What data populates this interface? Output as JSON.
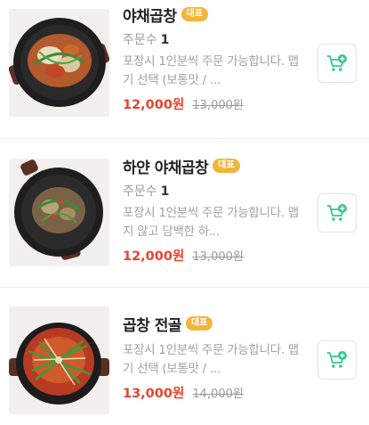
{
  "menu": {
    "items": [
      {
        "title": "야채곱창",
        "badge": "대표",
        "orders_label": "주문수",
        "orders_count": "1",
        "description": "포장시 1인분씩 주문 가능합니다. 맵기 선택 (보통맛 / ...",
        "price": "12,000원",
        "original_price": "13,000원",
        "image_icon": "stir-fried-tripe-pan-image"
      },
      {
        "title": "하얀 야채곱창",
        "badge": "대표",
        "orders_label": "주문수",
        "orders_count": "1",
        "description": "포장시 1인분씩 주문 가능합니다. 맵지 않고 담백한 하...",
        "price": "12,000원",
        "original_price": "13,000원",
        "image_icon": "white-tripe-pan-image"
      },
      {
        "title": "곱창 전골",
        "badge": "대표",
        "description": "포장시 1인분씩 주문 가능합니다. 맵기 선택 (보통맛 / ...",
        "price": "13,000원",
        "original_price": "14,000원",
        "image_icon": "tripe-hotpot-image"
      }
    ],
    "cart_icon": "add-to-cart-icon",
    "colors": {
      "price": "#e8442e",
      "badge": "#f2b43a",
      "cart_icon": "#35c88e"
    }
  }
}
